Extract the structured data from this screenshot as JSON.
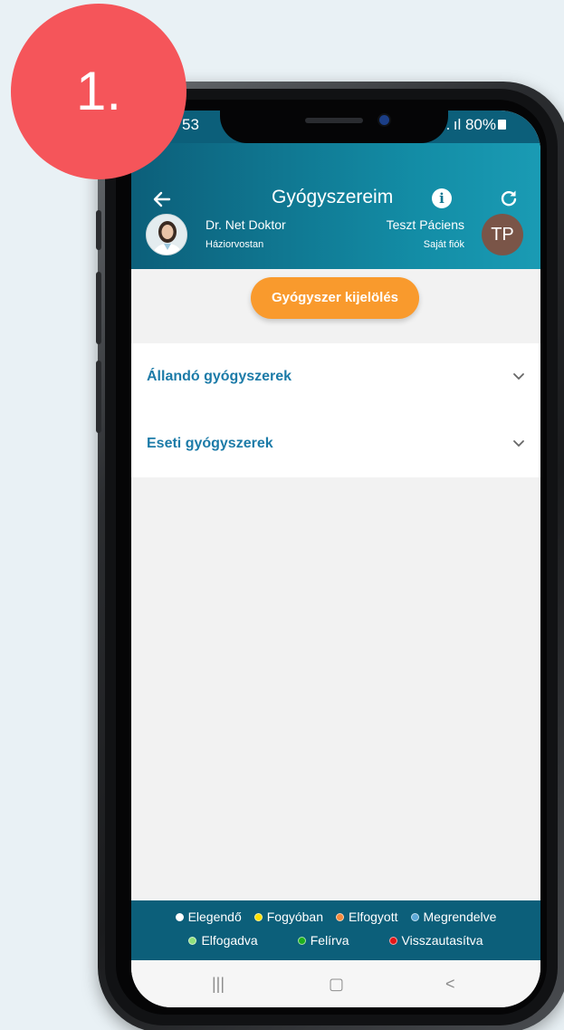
{
  "step_badge": "1.",
  "status": {
    "time": "53",
    "signal_battery": "… . ıl 80%"
  },
  "header": {
    "title": "Gyógyszereim",
    "doctor_name": "Dr. Net Doktor",
    "doctor_role": "Háziorvostan",
    "patient_name": "Teszt Páciens",
    "patient_role": "Saját fiók",
    "patient_initials": "TP"
  },
  "actions": {
    "select_button": "Gyógyszer kijelölés"
  },
  "accordion": [
    {
      "label": "Állandó gyógyszerek"
    },
    {
      "label": "Eseti gyógyszerek"
    }
  ],
  "legend": {
    "row1": [
      {
        "label": "Elegendő",
        "color": "#ffffff"
      },
      {
        "label": "Fogyóban",
        "color": "#ffe100"
      },
      {
        "label": "Elfogyott",
        "color": "#f58a3c"
      },
      {
        "label": "Megrendelve",
        "color": "#5ba8d8"
      }
    ],
    "row2": [
      {
        "label": "Elfogadva",
        "color": "#8fe07c"
      },
      {
        "label": "Felírva",
        "color": "#1db01d"
      },
      {
        "label": "Visszautasítva",
        "color": "#e31616"
      }
    ]
  },
  "nav": {
    "recents": "|||",
    "home": "▢",
    "back": "<"
  }
}
